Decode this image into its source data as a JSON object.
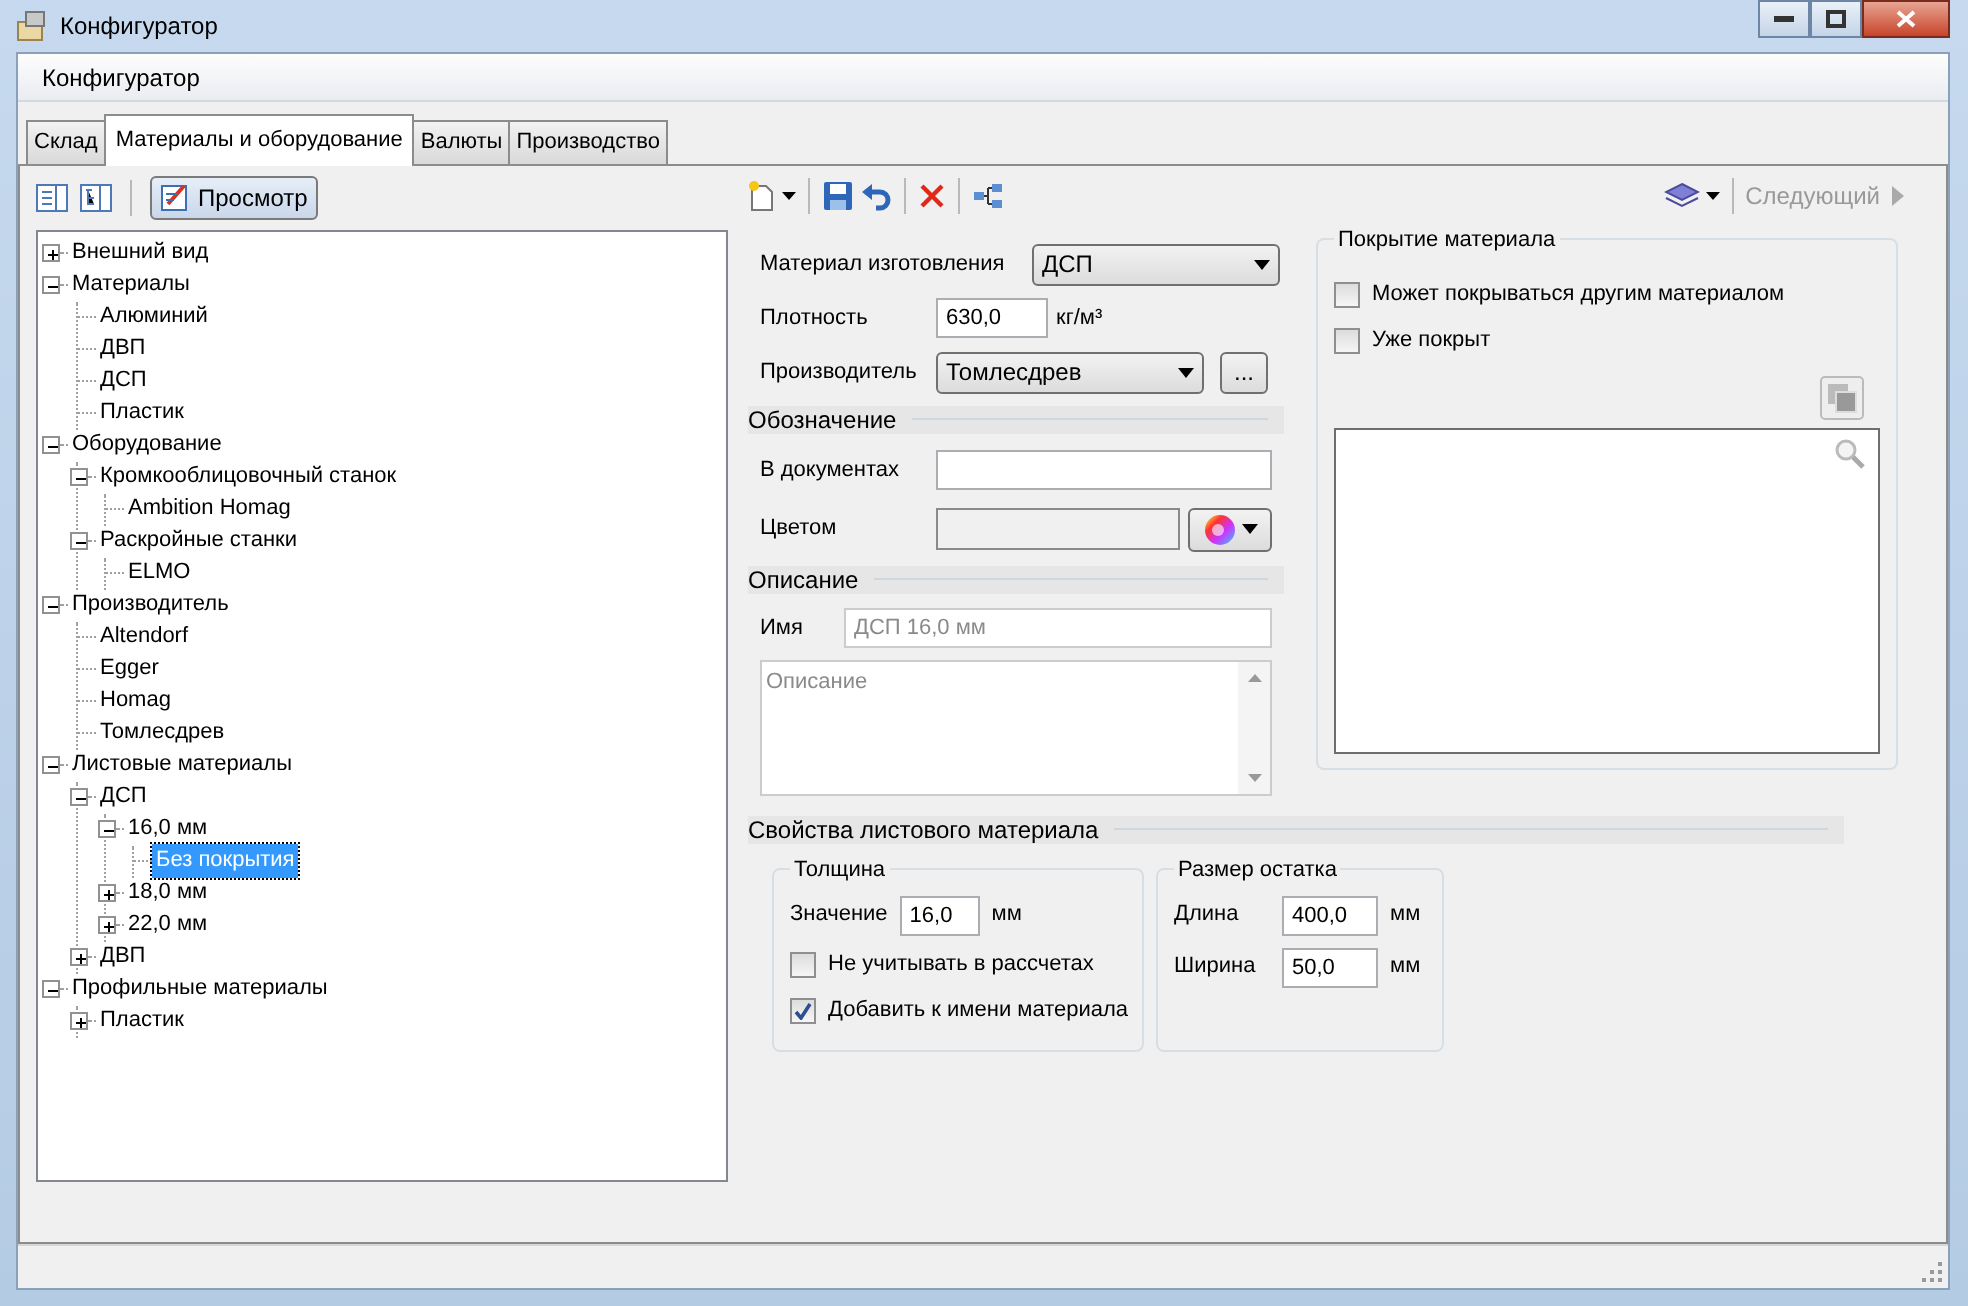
{
  "window": {
    "title": "Конфигуратор"
  },
  "header": {
    "title": "Конфигуратор"
  },
  "tabs": [
    {
      "label": "Склад",
      "selected": false
    },
    {
      "label": "Материалы и оборудование",
      "selected": true
    },
    {
      "label": "Валюты",
      "selected": false
    },
    {
      "label": "Производство",
      "selected": false
    }
  ],
  "tree_toolbar": {
    "view_button": {
      "label": "Просмотр",
      "selected": true
    }
  },
  "tree": [
    {
      "label": "Внешний вид",
      "expanded": false,
      "selected": false
    },
    {
      "label": "Материалы",
      "expanded": true,
      "selected": false,
      "children": [
        {
          "label": "Алюминий",
          "selected": false
        },
        {
          "label": "ДВП",
          "selected": false
        },
        {
          "label": "ДСП",
          "selected": false
        },
        {
          "label": "Пластик",
          "selected": false
        }
      ]
    },
    {
      "label": "Оборудование",
      "expanded": true,
      "selected": false,
      "children": [
        {
          "label": "Кромкооблицовочный станок",
          "expanded": true,
          "selected": false,
          "children": [
            {
              "label": "Ambition Homag",
              "selected": false
            }
          ]
        },
        {
          "label": "Раскройные станки",
          "expanded": true,
          "selected": false,
          "children": [
            {
              "label": "ELMO",
              "selected": false
            }
          ]
        }
      ]
    },
    {
      "label": "Производитель",
      "expanded": true,
      "selected": false,
      "children": [
        {
          "label": "Altendorf",
          "selected": false
        },
        {
          "label": "Egger",
          "selected": false
        },
        {
          "label": "Homag",
          "selected": false
        },
        {
          "label": "Томлесдрев",
          "selected": false
        }
      ]
    },
    {
      "label": "Листовые материалы",
      "expanded": true,
      "selected": false,
      "children": [
        {
          "label": "ДСП",
          "expanded": true,
          "selected": false,
          "children": [
            {
              "label": "16,0 мм",
              "expanded": true,
              "selected": false,
              "children": [
                {
                  "label": "Без покрытия",
                  "selected": true
                }
              ]
            },
            {
              "label": "18,0 мм",
              "expanded": false,
              "selected": false
            },
            {
              "label": "22,0 мм",
              "expanded": false,
              "selected": false
            }
          ]
        },
        {
          "label": "ДВП",
          "expanded": false,
          "selected": false
        }
      ]
    },
    {
      "label": "Профильные материалы",
      "expanded": true,
      "selected": false,
      "children": [
        {
          "label": "Пластик",
          "expanded": false,
          "selected": false
        }
      ]
    }
  ],
  "toolbar": {
    "next_button": {
      "label": "Следующий",
      "disabled": true
    }
  },
  "form": {
    "material": {
      "label": "Материал изготовления",
      "value": "ДСП"
    },
    "density": {
      "label": "Плотность",
      "value": "630,0",
      "unit": "кг/м³"
    },
    "manufacturer": {
      "label": "Производитель",
      "value": "Томлесдрев",
      "browse_label": "..."
    },
    "designation": {
      "title": "Обозначение",
      "documents_label": "В документах",
      "color_label": "Цветом"
    },
    "description": {
      "title": "Описание",
      "name_label": "Имя",
      "name_placeholder": "ДСП 16,0 мм",
      "text_placeholder": "Описание"
    },
    "coating": {
      "title": "Покрытие материала",
      "options": [
        {
          "label": "Может покрываться другим материалом",
          "checked": false
        },
        {
          "label": "Уже покрыт",
          "checked": false
        }
      ]
    },
    "sheet": {
      "title": "Свойства листового материала",
      "thickness": {
        "title": "Толщина",
        "value_label": "Значение",
        "value": "16,0",
        "unit": "мм",
        "options": [
          {
            "label": "Не учитывать в рассчетах",
            "checked": false
          },
          {
            "label": "Добавить к имени материала",
            "checked": true
          }
        ]
      },
      "remainder": {
        "title": "Размер остатка",
        "rows": [
          {
            "label": "Длина",
            "value": "400,0",
            "unit": "мм"
          },
          {
            "label": "Ширина",
            "value": "50,0",
            "unit": "мм"
          }
        ]
      }
    }
  }
}
